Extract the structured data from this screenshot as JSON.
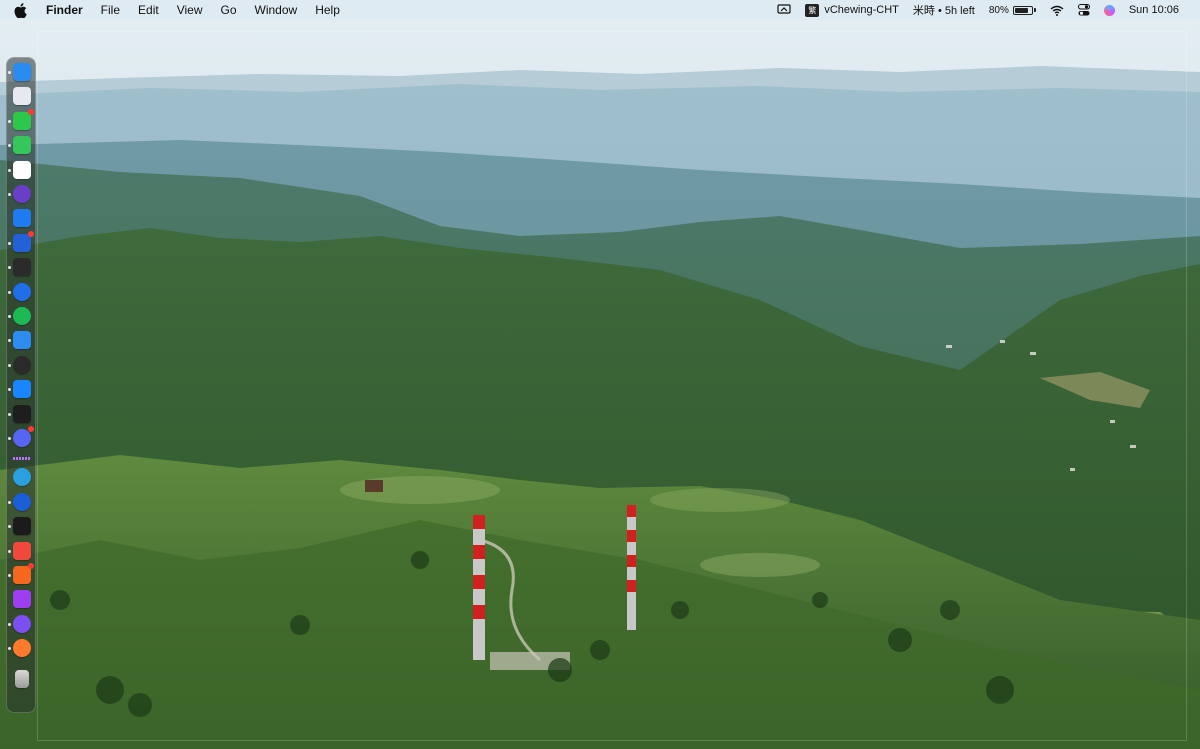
{
  "menubar": {
    "apple_icon": "apple-logo-icon",
    "app_name": "Finder",
    "menus": [
      "File",
      "Edit",
      "View",
      "Go",
      "Window",
      "Help"
    ],
    "status": {
      "screen_icon": "screen-mirroring-icon",
      "ime_badge": "繁",
      "ime_name": "vChewing-CHT",
      "timer_text": "米時 • 5h left",
      "battery_percent": "80%",
      "battery_level": 0.8,
      "wifi_icon": "wifi-icon",
      "control_center_icon": "control-center-icon",
      "siri_icon": "siri-icon",
      "clock": "Sun 10:06"
    }
  },
  "dock": {
    "apps": [
      {
        "name": "finder",
        "color": "#2a8cf0",
        "running": true
      },
      {
        "name": "photo-app",
        "color": "#e8e8f0",
        "running": false
      },
      {
        "name": "line",
        "color": "#2bc84a",
        "running": true,
        "badge": true
      },
      {
        "name": "messages",
        "color": "#35c759",
        "running": true
      },
      {
        "name": "text-editor",
        "color": "#ffffff",
        "running": true
      },
      {
        "name": "obsidian",
        "color": "#6a3fc8",
        "running": true
      },
      {
        "name": "bookmarks",
        "color": "#1e7bf2",
        "running": false
      },
      {
        "name": "tasks",
        "color": "#2361d8",
        "running": true,
        "badge": true
      },
      {
        "name": "screenshot-app",
        "color": "#2b2b2b",
        "running": true
      },
      {
        "name": "arc-browser",
        "color": "#1f6fe8",
        "running": true
      },
      {
        "name": "spotify",
        "color": "#1db954",
        "running": true
      },
      {
        "name": "mail",
        "color": "#2d8cf0",
        "running": true
      },
      {
        "name": "chatgpt",
        "color": "#2a2a2a",
        "running": true
      },
      {
        "name": "bluesky",
        "color": "#1985ff",
        "running": true
      },
      {
        "name": "figma",
        "color": "#1e1e1e",
        "running": true
      },
      {
        "name": "discord",
        "color": "#5865f2",
        "running": true,
        "badge": true
      },
      {
        "name": "telegram",
        "color": "#2aa0e0",
        "running": false
      },
      {
        "name": "1password",
        "color": "#1a5fd8",
        "running": true
      },
      {
        "name": "terminal",
        "color": "#1b1b1b",
        "running": true
      },
      {
        "name": "notes-red",
        "color": "#f0483d",
        "running": true
      },
      {
        "name": "feed-reader",
        "color": "#f5671e",
        "running": true,
        "badge": true
      },
      {
        "name": "podcasts",
        "color": "#9b3ff0",
        "running": false
      },
      {
        "name": "messenger",
        "color": "#7b4ff0",
        "running": true
      },
      {
        "name": "firefox",
        "color": "#ff7a2d",
        "running": true
      },
      {
        "name": "trash",
        "color": "#b8b8b8",
        "running": false
      }
    ]
  }
}
